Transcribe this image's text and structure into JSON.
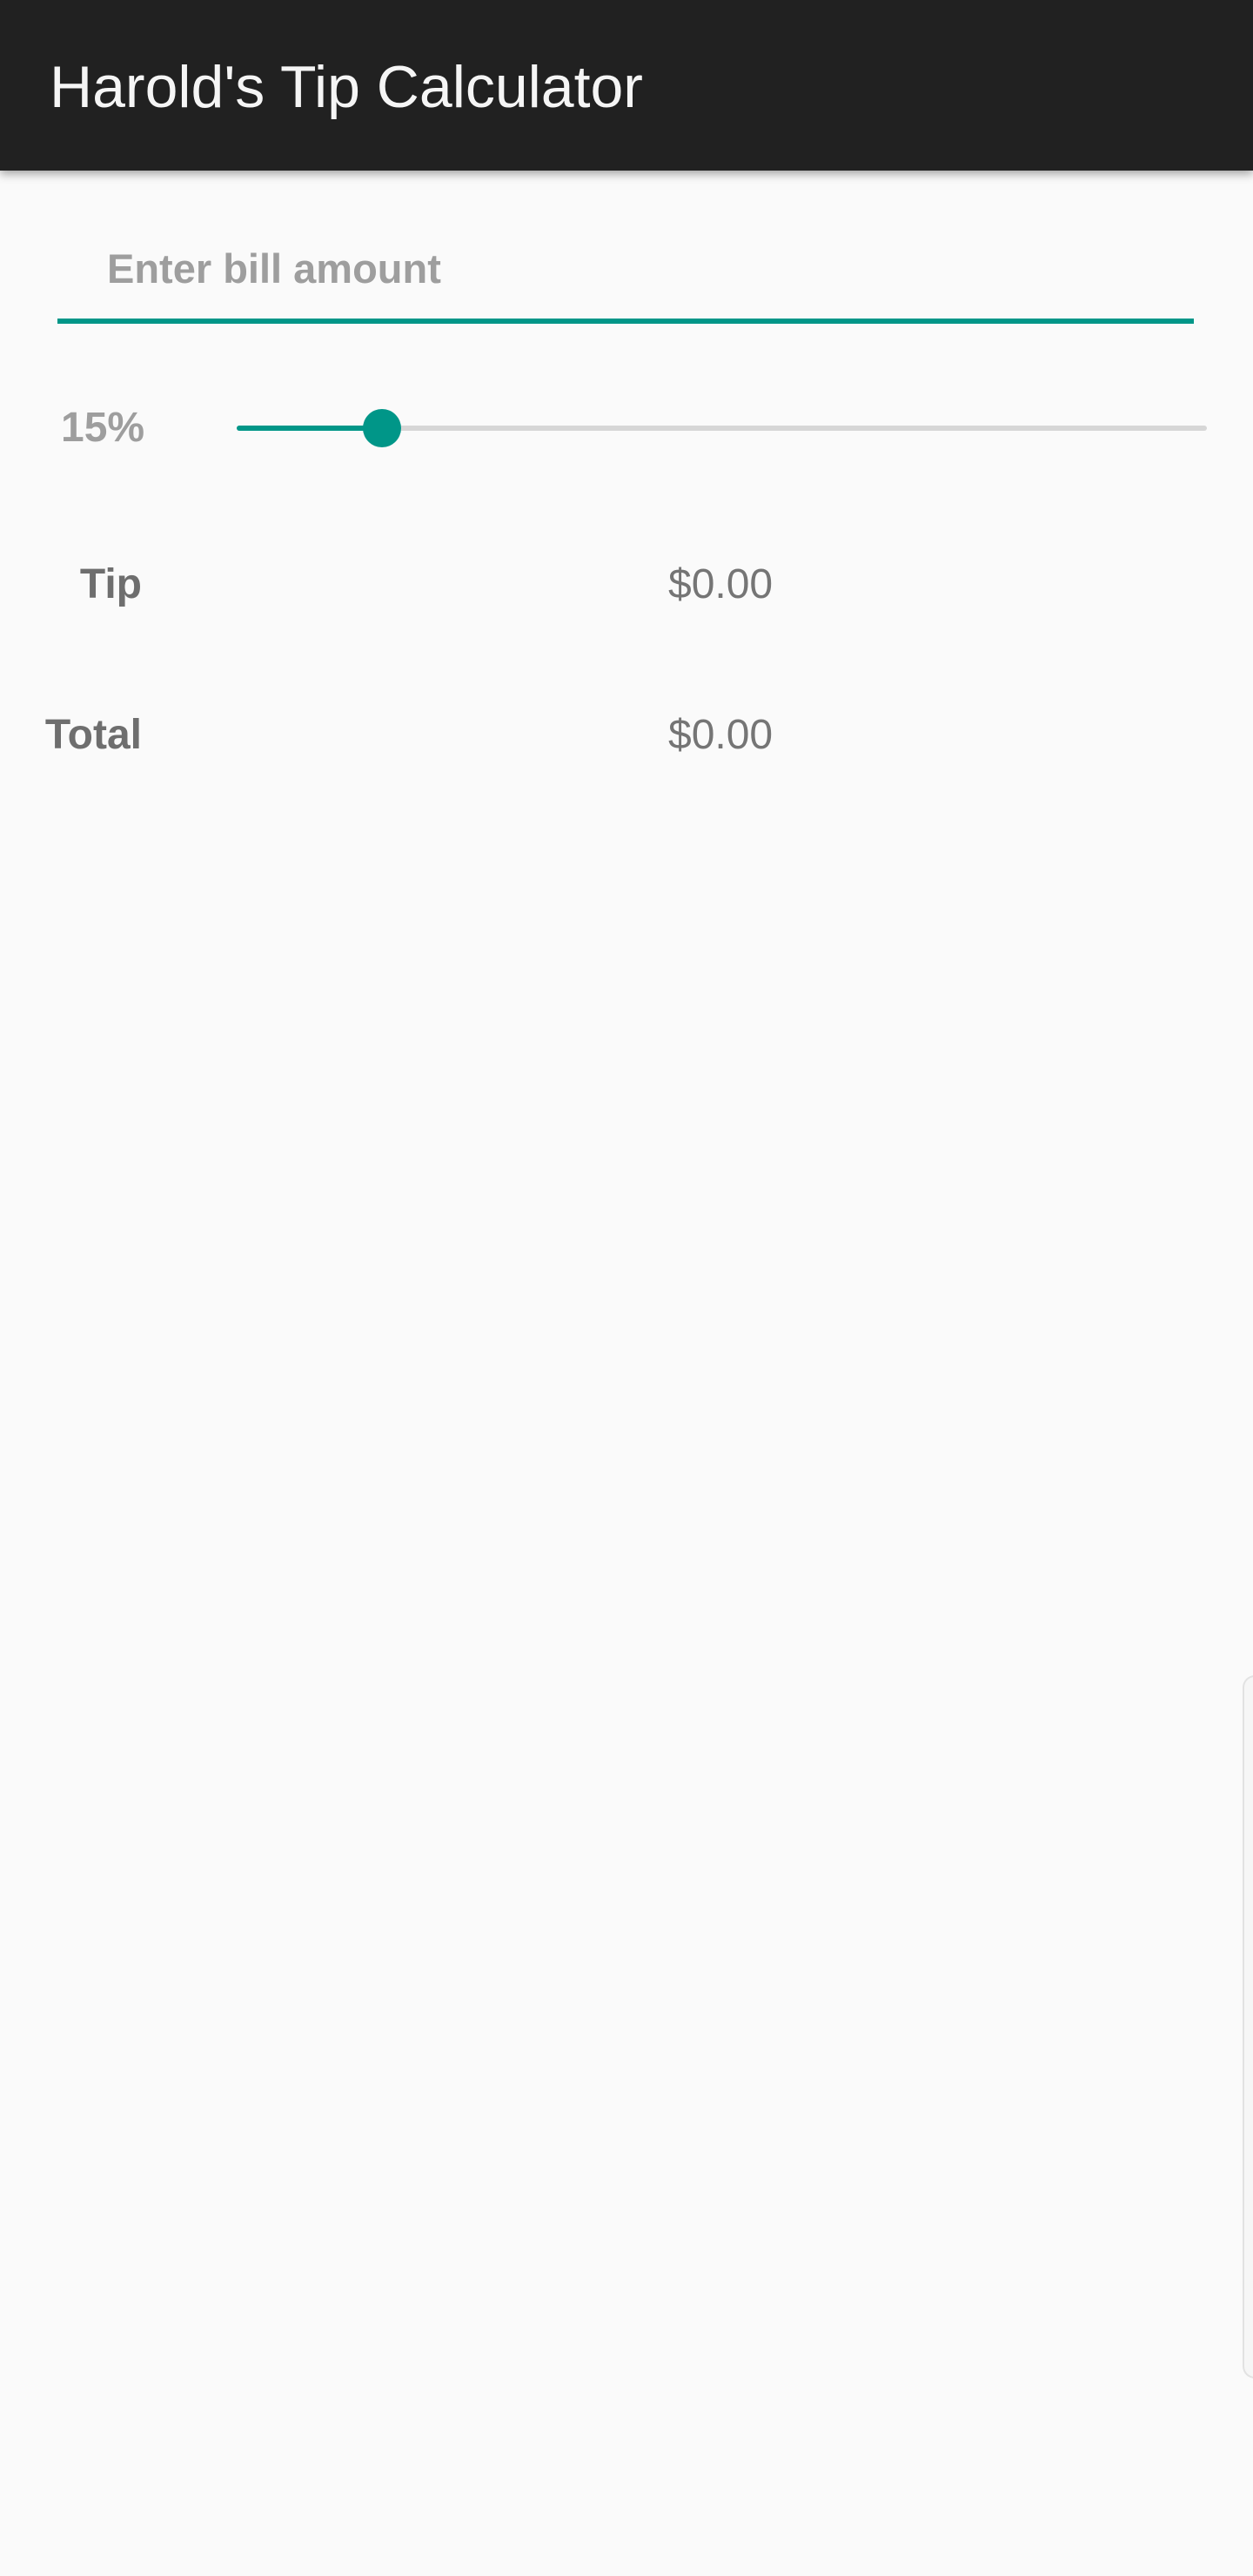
{
  "app": {
    "title": "Harold's Tip Calculator"
  },
  "bill": {
    "placeholder": "Enter bill amount",
    "value": ""
  },
  "tip_percent": {
    "label": "15%",
    "value": 15,
    "min": 0,
    "max": 100
  },
  "summary": {
    "tip_label": "Tip",
    "tip_value": "$0.00",
    "total_label": "Total",
    "total_value": "$0.00"
  },
  "colors": {
    "accent": "#009688",
    "app_bar": "#212121",
    "background": "#fafafa"
  }
}
